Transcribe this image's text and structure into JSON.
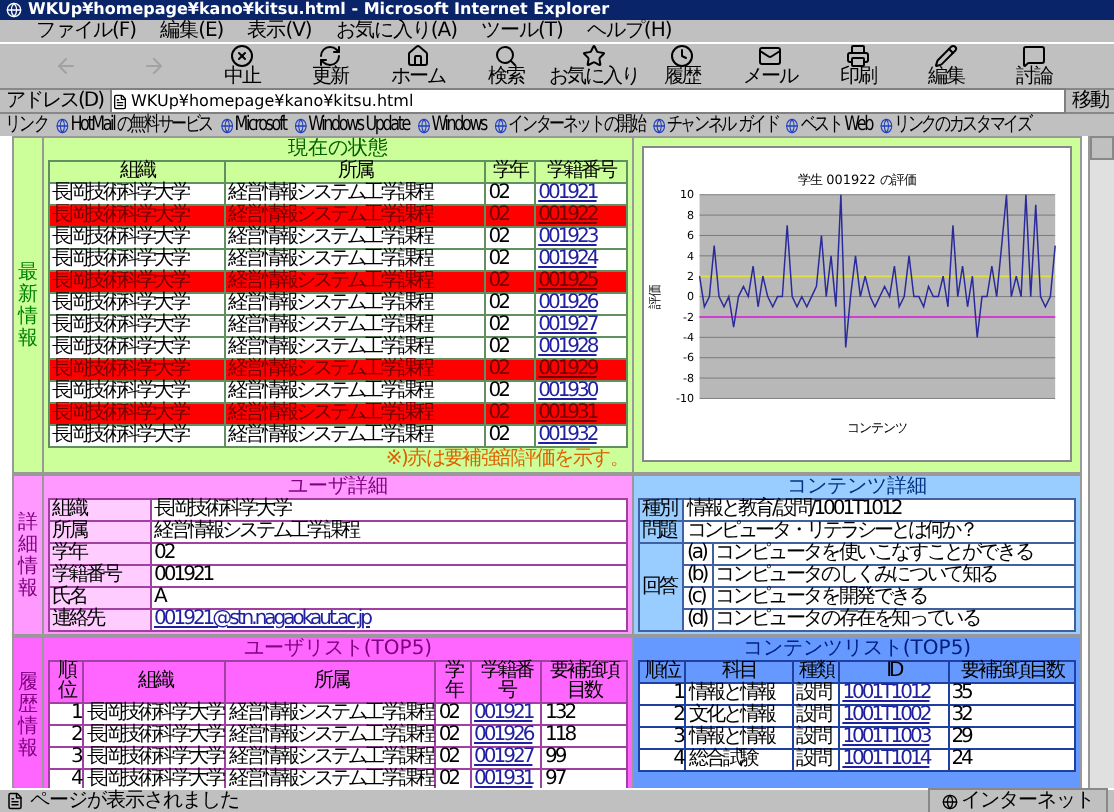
{
  "window": {
    "title": "WKUp¥homepage¥kano¥kitsu.html - Microsoft Internet Explorer"
  },
  "menu": [
    "ファイル(F)",
    "編集(E)",
    "表示(V)",
    "お気に入り(A)",
    "ツール(T)",
    "ヘルプ(H)"
  ],
  "toolbar": [
    {
      "kind": "back",
      "disabled": true
    },
    {
      "kind": "forward",
      "disabled": true
    },
    {
      "kind": "stop",
      "label": "中止",
      "disabled": false
    },
    {
      "kind": "refresh",
      "label": "更新",
      "disabled": false
    },
    {
      "kind": "home",
      "label": "ホーム",
      "disabled": false
    },
    {
      "kind": "search",
      "label": "検索",
      "disabled": false
    },
    {
      "kind": "favorites",
      "label": "お気に入り",
      "disabled": false
    },
    {
      "kind": "history",
      "label": "履歴",
      "disabled": false
    },
    {
      "kind": "mail",
      "label": "メール",
      "disabled": false
    },
    {
      "kind": "print",
      "label": "印刷",
      "disabled": false
    },
    {
      "kind": "edit",
      "label": "編集",
      "disabled": false
    },
    {
      "kind": "discuss",
      "label": "討論",
      "disabled": false
    }
  ],
  "address": {
    "label": "アドレス(D)",
    "value": "WKUp¥homepage¥kano¥kitsu.html",
    "go": "移動"
  },
  "links": {
    "label": "リンク",
    "items": [
      "HotMail の無料サービス",
      "Microsoft",
      "Windows Update",
      "Windows",
      "インターネットの開始",
      "チャンネル ガイド",
      "ベスト Web",
      "リンクのカスタマイズ"
    ]
  },
  "latest": {
    "side_label": "最新情報",
    "title": "現在の状態",
    "columns": [
      {
        "label": "組織"
      },
      {
        "label": "所属"
      },
      {
        "label": "学年"
      },
      {
        "label": "学籍番号",
        "kind": "link"
      }
    ],
    "rows": [
      {
        "cells": [
          "長岡技術科学大学",
          "経営情報システム工学課程",
          "02",
          "001921"
        ],
        "flagged": false
      },
      {
        "cells": [
          "長岡技術科学大学",
          "経営情報システム工学課程",
          "02",
          "001922"
        ],
        "flagged": true
      },
      {
        "cells": [
          "長岡技術科学大学",
          "経営情報システム工学課程",
          "02",
          "001923"
        ],
        "flagged": false
      },
      {
        "cells": [
          "長岡技術科学大学",
          "経営情報システム工学課程",
          "02",
          "001924"
        ],
        "flagged": false
      },
      {
        "cells": [
          "長岡技術科学大学",
          "経営情報システム工学課程",
          "02",
          "001925"
        ],
        "flagged": true
      },
      {
        "cells": [
          "長岡技術科学大学",
          "経営情報システム工学課程",
          "02",
          "001926"
        ],
        "flagged": false
      },
      {
        "cells": [
          "長岡技術科学大学",
          "経営情報システム工学課程",
          "02",
          "001927"
        ],
        "flagged": false
      },
      {
        "cells": [
          "長岡技術科学大学",
          "経営情報システム工学課程",
          "02",
          "001928"
        ],
        "flagged": false
      },
      {
        "cells": [
          "長岡技術科学大学",
          "経営情報システム工学課程",
          "02",
          "001929"
        ],
        "flagged": true
      },
      {
        "cells": [
          "長岡技術科学大学",
          "経営情報システム工学課程",
          "02",
          "001930"
        ],
        "flagged": false
      },
      {
        "cells": [
          "長岡技術科学大学",
          "経営情報システム工学課程",
          "02",
          "001931"
        ],
        "flagged": true
      },
      {
        "cells": [
          "長岡技術科学大学",
          "経営情報システム工学課程",
          "02",
          "001932"
        ],
        "flagged": false
      }
    ],
    "note": "※)赤は要補強部評価を示す。",
    "chart_data": {
      "type": "line",
      "title": "学生 001922 の評価",
      "xlabel": "コンテンツ",
      "ylabel": "評価",
      "ylim": [
        -10,
        10
      ],
      "yticks": [
        -10,
        -8,
        -6,
        -4,
        -2,
        0,
        2,
        4,
        6,
        8,
        10
      ],
      "grid": true,
      "values": [
        2,
        -1,
        0,
        5,
        0,
        -1,
        0,
        -3,
        0,
        1,
        0,
        3,
        -1,
        2,
        0,
        -1,
        0,
        0,
        7,
        0,
        -1,
        0,
        -1,
        0,
        1,
        6,
        0,
        4,
        -1,
        10,
        -5,
        0,
        4,
        0,
        2,
        0,
        -1,
        0,
        1,
        0,
        3,
        -1,
        0,
        4,
        0,
        0,
        -1,
        1,
        0,
        0,
        2,
        -1,
        7,
        0,
        3,
        -1,
        2,
        -4,
        0,
        0,
        3,
        0,
        5,
        10,
        0,
        2,
        0,
        10,
        0,
        9,
        0,
        -1,
        0,
        5
      ],
      "ref_lines": [
        {
          "axis": "y",
          "value": 2,
          "color": "#e0e040"
        },
        {
          "axis": "y",
          "value": -2,
          "color": "#d040d0"
        }
      ]
    }
  },
  "detail": {
    "side_label": "詳細情報",
    "user": {
      "title": "ユーザ詳細",
      "fields": [
        {
          "label": "組織",
          "value": "長岡技術科学大学"
        },
        {
          "label": "所属",
          "value": "経営情報システム工学課程"
        },
        {
          "label": "学年",
          "value": "02"
        },
        {
          "label": "学籍番号",
          "value": "001921"
        },
        {
          "label": "氏名",
          "value": "A"
        },
        {
          "label": "連絡先",
          "value": "001921@stn.nagaokaut.ac.jp",
          "kind": "link"
        }
      ]
    },
    "content": {
      "title": "コンテンツ詳細",
      "type_label": "種別",
      "type_value": "情報と教育/設問/1001T1012",
      "question_label": "問題",
      "question": "コンピュータ・リテラシーとは何か？",
      "answers_label": "回答",
      "answers": [
        {
          "key": "(a)",
          "text": "コンピュータを使いこなすことができる"
        },
        {
          "key": "(b)",
          "text": "コンピュータのしくみについて知る"
        },
        {
          "key": "(c)",
          "text": "コンピュータを開発できる"
        },
        {
          "key": "(d)",
          "text": "コンピュータの存在を知っている"
        }
      ]
    }
  },
  "history": {
    "side_label": "履歴情報",
    "users": {
      "title": "ユーザリスト(TOP5)",
      "columns": [
        {
          "label": "順位",
          "kind": "rank"
        },
        {
          "label": "組織"
        },
        {
          "label": "所属"
        },
        {
          "label": "学年"
        },
        {
          "label": "学籍番号",
          "kind": "link"
        },
        {
          "label": "要補強項目数"
        }
      ],
      "rows": [
        [
          "1",
          "長岡技術科学大学",
          "経営情報システム工学課程",
          "02",
          "001921",
          "132"
        ],
        [
          "2",
          "長岡技術科学大学",
          "経営情報システム工学課程",
          "02",
          "001926",
          "118"
        ],
        [
          "3",
          "長岡技術科学大学",
          "経営情報システム工学課程",
          "02",
          "001927",
          "99"
        ],
        [
          "4",
          "長岡技術科学大学",
          "経営情報システム工学課程",
          "02",
          "001931",
          "97"
        ]
      ]
    },
    "contents": {
      "title": "コンテンツリスト(TOP5)",
      "columns": [
        {
          "label": "順位",
          "kind": "rank"
        },
        {
          "label": "科目"
        },
        {
          "label": "種類"
        },
        {
          "label": "ID",
          "kind": "link"
        },
        {
          "label": "要補強項目数"
        }
      ],
      "rows": [
        [
          "1",
          "情報と情報",
          "設問",
          "1001T1012",
          "35"
        ],
        [
          "2",
          "文化と情報",
          "設問",
          "1001T1002",
          "32"
        ],
        [
          "3",
          "情報と情報",
          "設問",
          "1001T1003",
          "29"
        ],
        [
          "4",
          "総合試験",
          "設問",
          "1001T1014",
          "24"
        ]
      ]
    }
  },
  "status": {
    "text": "ページが表示されました",
    "zone": "インターネット"
  }
}
